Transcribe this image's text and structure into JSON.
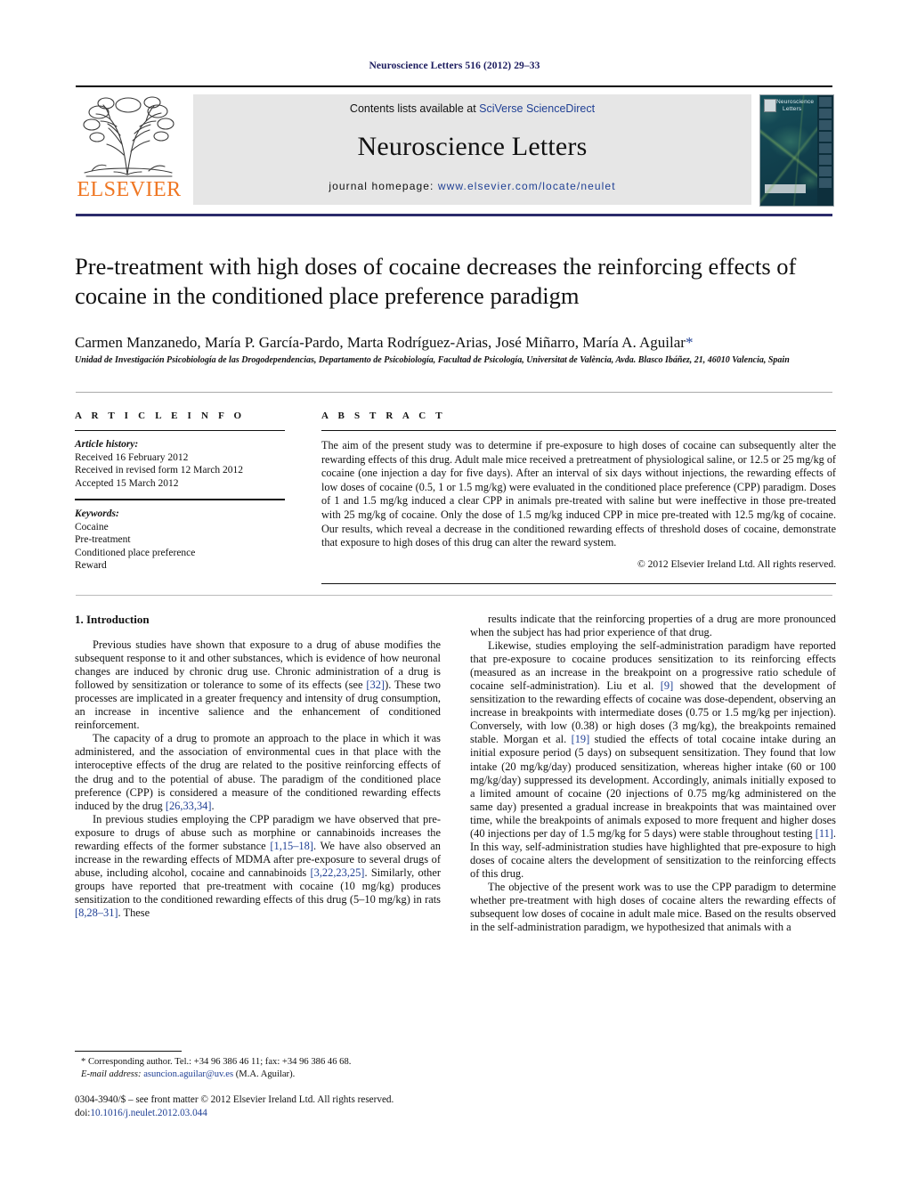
{
  "running_head": "Neuroscience Letters 516 (2012) 29–33",
  "header": {
    "publisher_name": "ELSEVIER",
    "contents_prefix": "Contents lists available at ",
    "contents_link": "SciVerse ScienceDirect",
    "journal_name": "Neuroscience Letters",
    "homepage_label": "journal homepage:",
    "homepage_url": "www.elsevier.com/locate/neulet",
    "cover_title_line1": "Neuroscience",
    "cover_title_line2": "Letters"
  },
  "article": {
    "title": "Pre-treatment with high doses of cocaine decreases the reinforcing effects of cocaine in the conditioned place preference paradigm",
    "authors": "Carmen Manzanedo, María P. García-Pardo, Marta Rodríguez-Arias, José Miñarro, María A. Aguilar",
    "corresponding_marker": "*",
    "affiliation": "Unidad de Investigación Psicobiología de las Drogodependencias, Departamento de Psicobiología, Facultad de Psicología, Universitat de València, Avda. Blasco Ibáñez, 21, 46010 Valencia, Spain"
  },
  "article_info": {
    "heading": "A R T I C L E    I N F O",
    "history_label": "Article history:",
    "history": [
      "Received 16 February 2012",
      "Received in revised form 12 March 2012",
      "Accepted 15 March 2012"
    ],
    "keywords_label": "Keywords:",
    "keywords": [
      "Cocaine",
      "Pre-treatment",
      "Conditioned place preference",
      "Reward"
    ]
  },
  "abstract": {
    "heading": "A B S T R A C T",
    "text": "The aim of the present study was to determine if pre-exposure to high doses of cocaine can subsequently alter the rewarding effects of this drug. Adult male mice received a pretreatment of physiological saline, or 12.5 or 25 mg/kg of cocaine (one injection a day for five days). After an interval of six days without injections, the rewarding effects of low doses of cocaine (0.5, 1 or 1.5 mg/kg) were evaluated in the conditioned place preference (CPP) paradigm. Doses of 1 and 1.5 mg/kg induced a clear CPP in animals pre-treated with saline but were ineffective in those pre-treated with 25 mg/kg of cocaine. Only the dose of 1.5 mg/kg induced CPP in mice pre-treated with 12.5 mg/kg of cocaine. Our results, which reveal a decrease in the conditioned rewarding effects of threshold doses of cocaine, demonstrate that exposure to high doses of this drug can alter the reward system.",
    "copyright": "© 2012 Elsevier Ireland Ltd. All rights reserved."
  },
  "body": {
    "section_number_title": "1.  Introduction",
    "left_paragraphs": [
      "Previous studies have shown that exposure to a drug of abuse modifies the subsequent response to it and other substances, which is evidence of how neuronal changes are induced by chronic drug use. Chronic administration of a drug is followed by sensitization or tolerance to some of its effects (see [32]). These two processes are implicated in a greater frequency and intensity of drug consumption, an increase in incentive salience and the enhancement of conditioned reinforcement.",
      "The capacity of a drug to promote an approach to the place in which it was administered, and the association of environmental cues in that place with the interoceptive effects of the drug are related to the positive reinforcing effects of the drug and to the potential of abuse. The paradigm of the conditioned place preference (CPP) is considered a measure of the conditioned rewarding effects induced by the drug [26,33,34].",
      "In previous studies employing the CPP paradigm we have observed that pre-exposure to drugs of abuse such as morphine or cannabinoids increases the rewarding effects of the former substance [1,15–18]. We have also observed an increase in the rewarding effects of MDMA after pre-exposure to several drugs of abuse, including alcohol, cocaine and cannabinoids [3,22,23,25]. Similarly, other groups have reported that pre-treatment with cocaine (10 mg/kg) produces sensitization to the conditioned rewarding effects of this drug (5–10 mg/kg) in rats [8,28–31]. These"
    ],
    "right_paragraphs": [
      "results indicate that the reinforcing properties of a drug are more pronounced when the subject has had prior experience of that drug.",
      "Likewise, studies employing the self-administration paradigm have reported that pre-exposure to cocaine produces sensitization to its reinforcing effects (measured as an increase in the breakpoint on a progressive ratio schedule of cocaine self-administration). Liu et al. [9] showed that the development of sensitization to the rewarding effects of cocaine was dose-dependent, observing an increase in breakpoints with intermediate doses (0.75 or 1.5 mg/kg per injection). Conversely, with low (0.38) or high doses (3 mg/kg), the breakpoints remained stable. Morgan et al. [19] studied the effects of total cocaine intake during an initial exposure period (5 days) on subsequent sensitization. They found that low intake (20 mg/kg/day) produced sensitization, whereas higher intake (60 or 100 mg/kg/day) suppressed its development. Accordingly, animals initially exposed to a limited amount of cocaine (20 injections of 0.75 mg/kg administered on the same day) presented a gradual increase in breakpoints that was maintained over time, while the breakpoints of animals exposed to more frequent and higher doses (40 injections per day of 1.5 mg/kg for 5 days) were stable throughout testing [11]. In this way, self-administration studies have highlighted that pre-exposure to high doses of cocaine alters the development of sensitization to the reinforcing effects of this drug.",
      "The objective of the present work was to use the CPP paradigm to determine whether pre-treatment with high doses of cocaine alters the rewarding effects of subsequent low doses of cocaine in adult male mice. Based on the results observed in the self-administration paradigm, we hypothesized that animals with a"
    ]
  },
  "footer": {
    "corresponding_note": "* Corresponding author. Tel.: +34 96 386 46 11; fax: +34 96 386 46 68.",
    "email_label": "E-mail address:",
    "email": "asuncion.aguilar@uv.es",
    "email_suffix": "(M.A. Aguilar).",
    "issn_line": "0304-3940/$ – see front matter © 2012 Elsevier Ireland Ltd. All rights reserved.",
    "doi_label": "doi:",
    "doi": "10.1016/j.neulet.2012.03.044"
  },
  "colors": {
    "link": "#1f3f94",
    "running_head": "#1b1b5e",
    "elsevier_orange": "#ef7622",
    "header_band": "#e6e6e6"
  }
}
